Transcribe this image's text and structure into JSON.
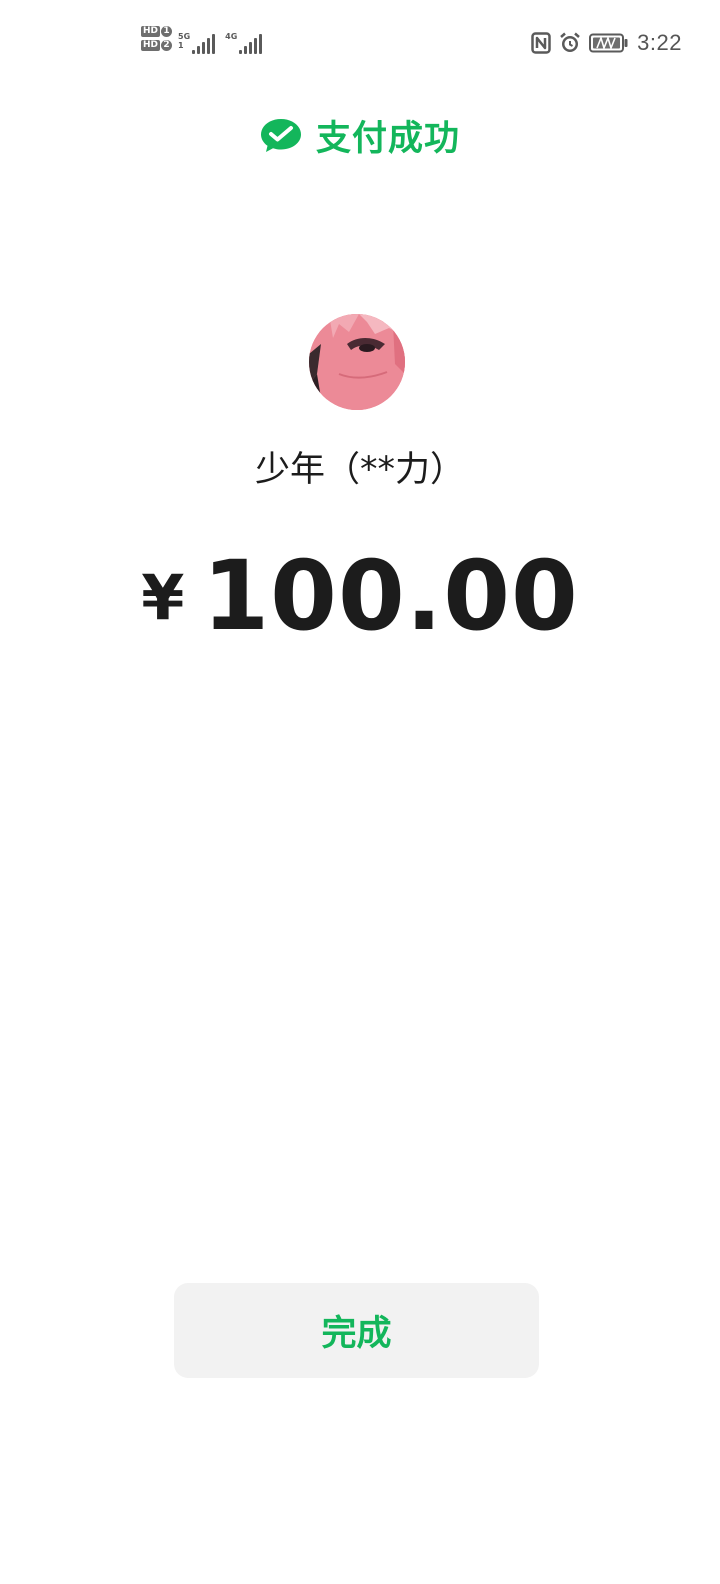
{
  "status_bar": {
    "sim1_label": "HD",
    "sim1_num": "1",
    "sim2_label": "HD",
    "sim2_num": "2",
    "net1_type": "5G",
    "net1_sub": "1",
    "net2_type": "4G",
    "time": "3:22",
    "icons": [
      "nfc-icon",
      "alarm-icon",
      "battery-icon"
    ]
  },
  "header": {
    "icon": "wechat-pay-icon",
    "title": "支付成功",
    "accent_color": "#13b65b"
  },
  "payee": {
    "avatar_icon": "avatar",
    "name": "少年（**力）"
  },
  "payment": {
    "currency_symbol": "¥",
    "amount": "100.00"
  },
  "actions": {
    "done_label": "完成"
  }
}
